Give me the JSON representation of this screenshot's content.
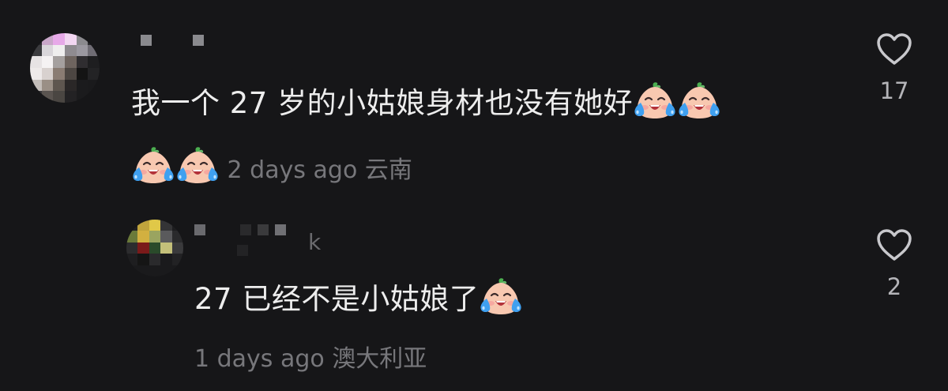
{
  "comments": [
    {
      "text": "我一个 27 岁的小姑娘身材也没有她好",
      "emoji_count": 4,
      "time": "2 days ago",
      "location": "云南",
      "likes": "17",
      "emoji_icon": "loudly-crying-face-icon"
    },
    {
      "name_fragment": "k",
      "text": "27 已经不是小姑娘了",
      "emoji_count": 1,
      "time": "1 days ago",
      "location": "澳大利亚",
      "likes": "2",
      "emoji_icon": "loudly-crying-face-icon"
    }
  ],
  "icons": {
    "like": "heart-outline-icon"
  },
  "colors": {
    "background": "#161618",
    "text": "#ededed",
    "meta": "#77777b",
    "like": "#b4b4b8"
  }
}
